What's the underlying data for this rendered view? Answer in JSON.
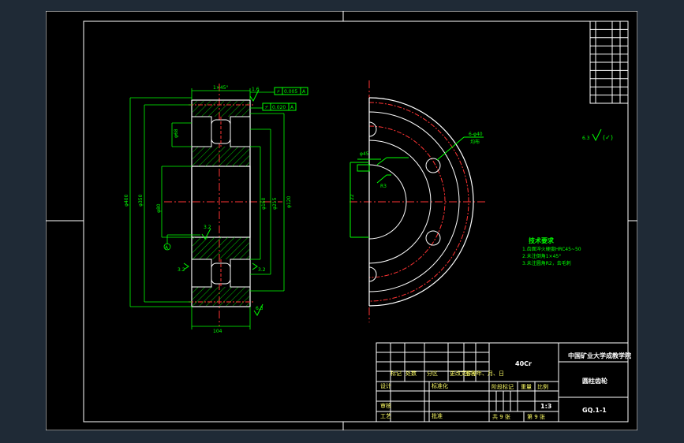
{
  "title_block": {
    "university": "中国矿业大学成教学院",
    "material": "40Cr",
    "part_name": "圆柱齿轮",
    "drawing_no": "GQ.1-1",
    "scale_label": "比例",
    "weight_label": "重量",
    "stage_label": "阶段标记",
    "scale": "1:3",
    "sheets_total": "共 9 张",
    "sheet_no": "第 9 张",
    "rev_headers": [
      "标记",
      "处数",
      "分区",
      "更改文件号",
      "签名",
      "年、月、日"
    ],
    "designer_label": "设计",
    "standardize_label": "标准化",
    "review_label": "审核",
    "process_label": "工艺",
    "approve_label": "批准"
  },
  "notes": {
    "heading": "技术要求",
    "items": [
      "1.齿面淬火硬度HRC45~50",
      "2.未注倒角1×45°",
      "3.未注圆角R2，去毛刺"
    ]
  },
  "section_view": {
    "dims": [
      "φ400",
      "φ350",
      "φ215",
      "φ160",
      "φ80",
      "φ68",
      "φ120",
      "104"
    ],
    "roughness": [
      "1.6",
      "3.2",
      "3.2",
      "3.2",
      "6.3"
    ],
    "tolerance_frames": [
      [
        "⌿",
        "0.005",
        "A"
      ],
      [
        "⌿",
        "0.020",
        "A"
      ]
    ],
    "datum": "A",
    "chamfer": "1×45°"
  },
  "front_view": {
    "labels": [
      "6-φ40",
      "均布",
      "R3",
      "φ45",
      "22"
    ],
    "roughness_mark": "6.3"
  },
  "param_table": {
    "rows": 10
  }
}
